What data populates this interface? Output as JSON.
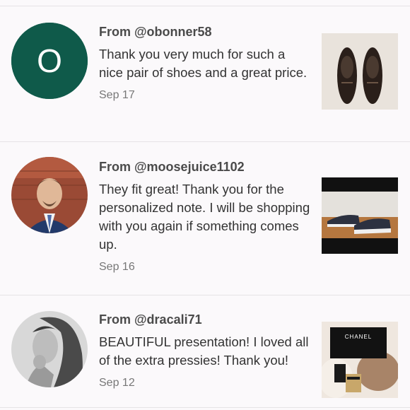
{
  "reviews": [
    {
      "from": "From @obonner58",
      "message": "Thank you very much for such a nice pair of shoes and a great price.",
      "date": "Sep 17",
      "avatar_letter": "O",
      "avatar_color": "#0f5a4a"
    },
    {
      "from": "From @moosejuice1102",
      "message": "They fit great! Thank you for the personalized note. I will be shopping with you again if something comes up.",
      "date": "Sep 16"
    },
    {
      "from": "From @dracali71",
      "message": "BEAUTIFUL presentation! I loved all of the extra pressies! Thank you!",
      "date": "Sep 12",
      "thumb_brand": "CHANEL"
    }
  ]
}
